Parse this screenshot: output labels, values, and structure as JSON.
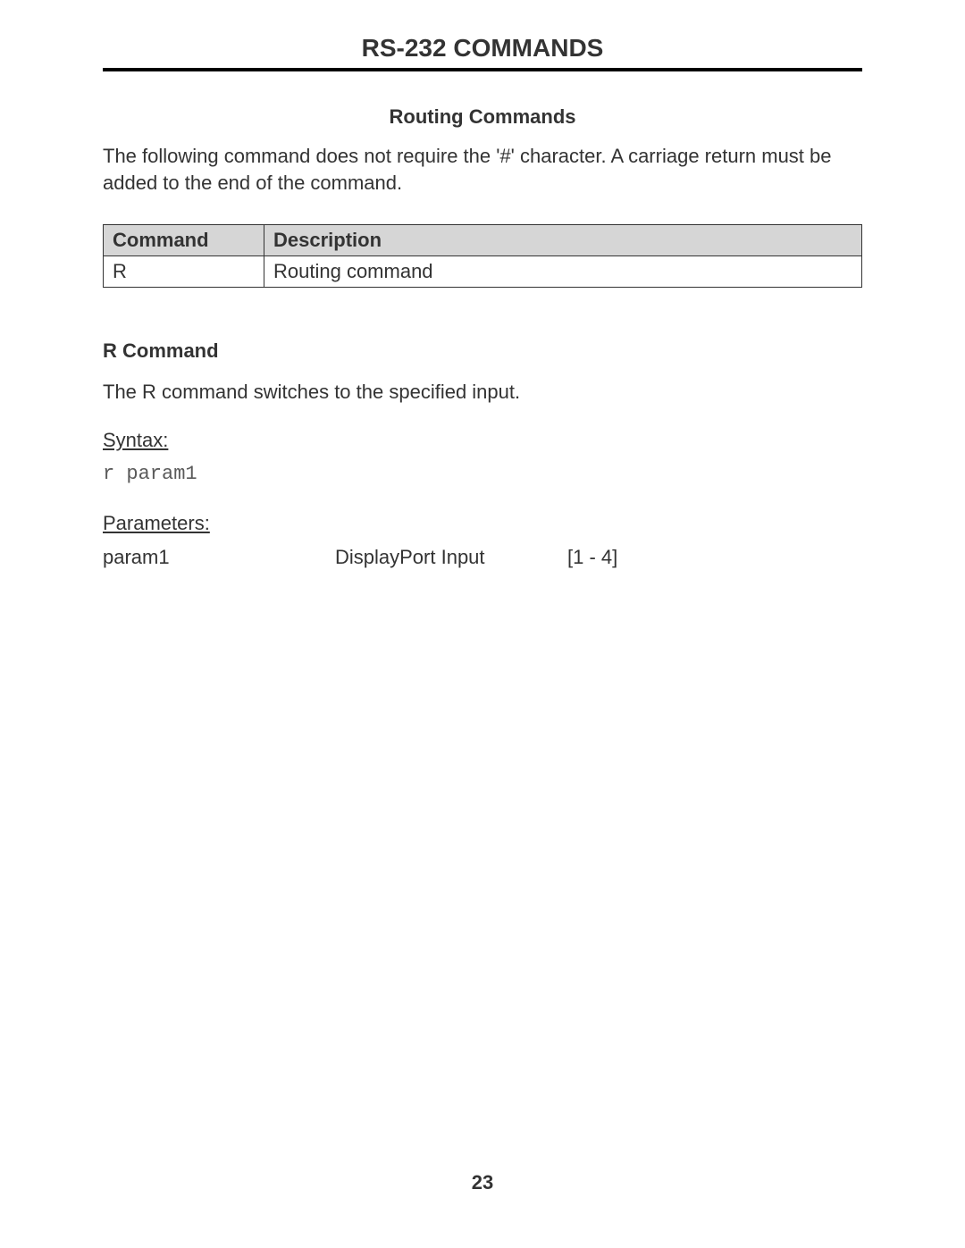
{
  "header": {
    "title": "RS-232 COMMANDS"
  },
  "section": {
    "heading": "Routing Commands",
    "intro": "The following command does not require the '#' character.  A carriage return must be added to the end of the command."
  },
  "table": {
    "headers": {
      "command": "Command",
      "description": "Description"
    },
    "rows": [
      {
        "command": "R",
        "description": "Routing command"
      }
    ]
  },
  "subsection": {
    "heading": "R Command",
    "description": "The R command switches to the speciﬁed input.",
    "syntax_label": "Syntax:",
    "syntax_code": "r param1",
    "parameters_label": "Parameters:",
    "parameters": [
      {
        "name": "param1",
        "type": "DisplayPort Input",
        "range": "[1 - 4]"
      }
    ]
  },
  "footer": {
    "page_number": "23"
  }
}
